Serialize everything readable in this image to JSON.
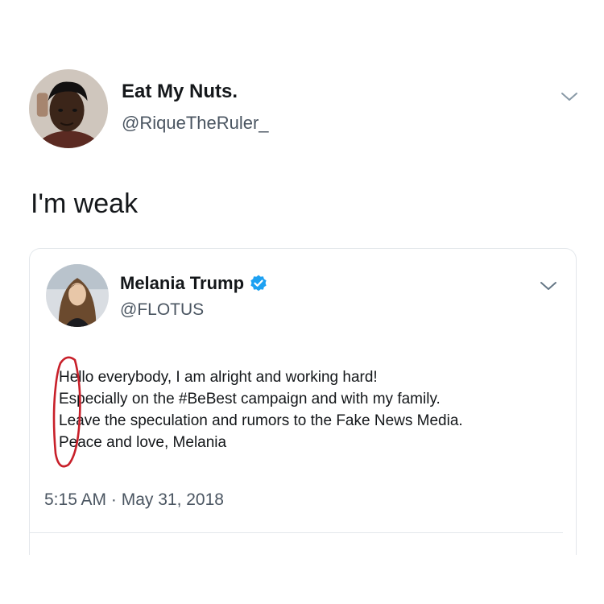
{
  "outer_tweet": {
    "display_name": "Eat My Nuts.",
    "handle": "@RiqueTheRuler_",
    "text": "I'm weak"
  },
  "quoted_tweet": {
    "display_name": "Melania Trump",
    "handle": "@FLOTUS",
    "lines": [
      "Hello everybody, I am alright and working hard!",
      "Especially on the #BeBest campaign and with my family.",
      "Leave the speculation and rumors to the Fake News Media.",
      "Peace and love, Melania"
    ],
    "timestamp": "5:15 AM · May 31, 2018"
  },
  "colors": {
    "text": "#14171a",
    "secondary_text": "#4a5561",
    "verified_blue": "#1da1f2",
    "annotation_red": "#c8202a",
    "border": "#e3e7eb"
  },
  "icons": {
    "outer_chevron": "chevron-down-icon",
    "inner_chevron": "chevron-down-icon",
    "verified": "verified-badge-icon"
  }
}
